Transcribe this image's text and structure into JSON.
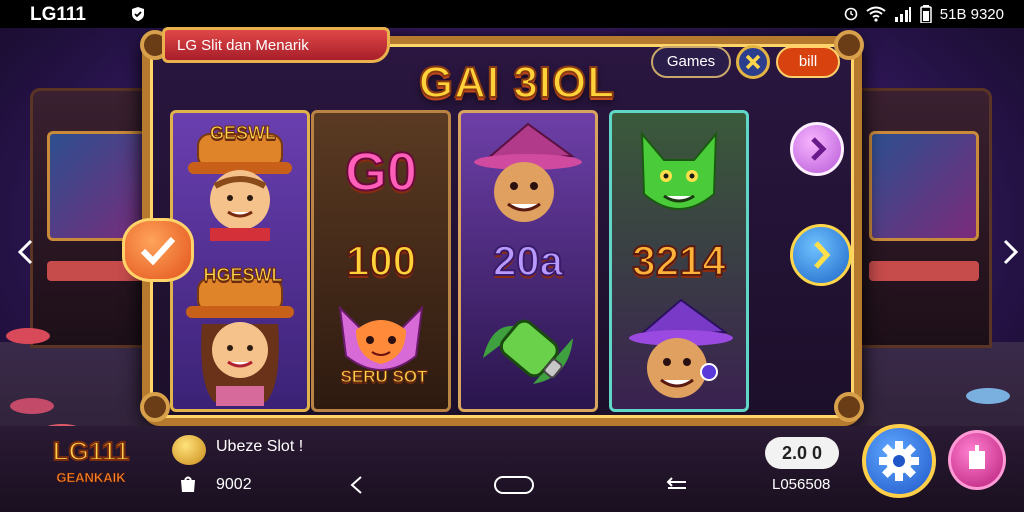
{
  "status_bar": {
    "app_name": "LG111",
    "right_text": "51B 9320",
    "icons": [
      "shield-icon",
      "alarm-icon",
      "wifi-icon",
      "signal-icon",
      "battery-icon"
    ]
  },
  "machine": {
    "banner_title": "LG Slit dan Menarik",
    "logo": "GAI 3IOL",
    "games_button": "Games",
    "bill_button": "bill"
  },
  "reels": {
    "r1": {
      "top_label": "GESWL",
      "bottom_label": "HGESWL"
    },
    "r2": {
      "top_number": "G0",
      "mid_number": "100",
      "bottom_caption": "SERU SOT"
    },
    "r3": {
      "mid_number": "20a"
    },
    "r4": {
      "mid_number": "3214"
    }
  },
  "bottom": {
    "brand_line1": "LG111",
    "brand_line2": "GEANKAIK",
    "message": "Ubeze Slot !",
    "bag_value": "9002",
    "credit": "2.0 0",
    "credit_id": "L056508"
  },
  "colors": {
    "frame_gold": "#b57a2e",
    "accent_orange": "#e2541c",
    "accent_blue": "#1e66c8",
    "accent_pink": "#b81f7a"
  }
}
